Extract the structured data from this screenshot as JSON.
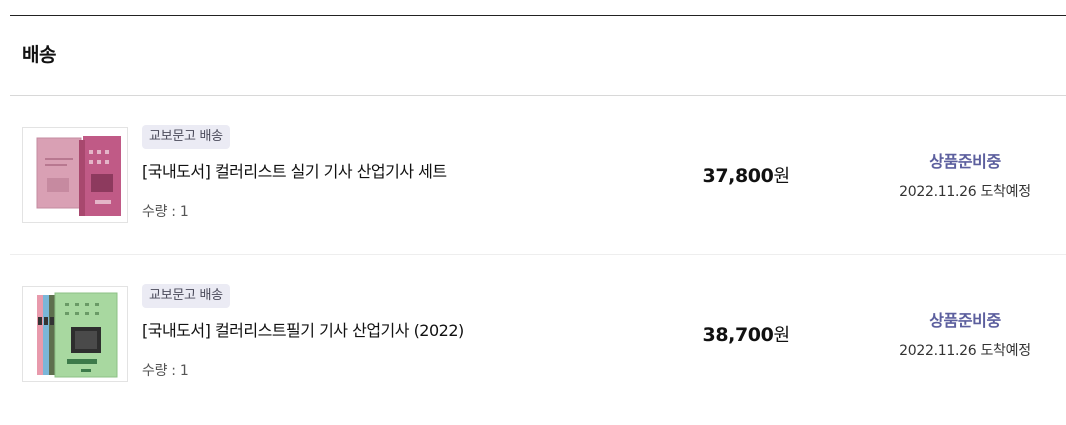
{
  "section": {
    "title": "배송"
  },
  "items": [
    {
      "badge": "교보문고 배송",
      "name": "[국내도서] 컬러리스트 실기 기사 산업기사 세트",
      "quantity": "수량 : 1",
      "price": "37,800",
      "price_unit": "원",
      "status": "상품준비중",
      "eta": "2022.11.26 도착예정",
      "thumbnail_icon": "book-set-pink-cover-image",
      "cover_colors": [
        "#d9a0b4",
        "#c05a86"
      ]
    },
    {
      "badge": "교보문고 배송",
      "name": "[국내도서] 컬러리스트필기 기사 산업기사 (2022)",
      "quantity": "수량 : 1",
      "price": "38,700",
      "price_unit": "원",
      "status": "상품준비중",
      "eta": "2022.11.26 도착예정",
      "thumbnail_icon": "book-set-green-cover-image",
      "cover_colors": [
        "#a8d8a0",
        "#e89aac",
        "#7ab6d8"
      ]
    }
  ],
  "colors": {
    "status": "#5c5f9e",
    "badge_bg": "#ebebf4",
    "top_rule": "#222222",
    "divider": "#d8d8d8"
  }
}
